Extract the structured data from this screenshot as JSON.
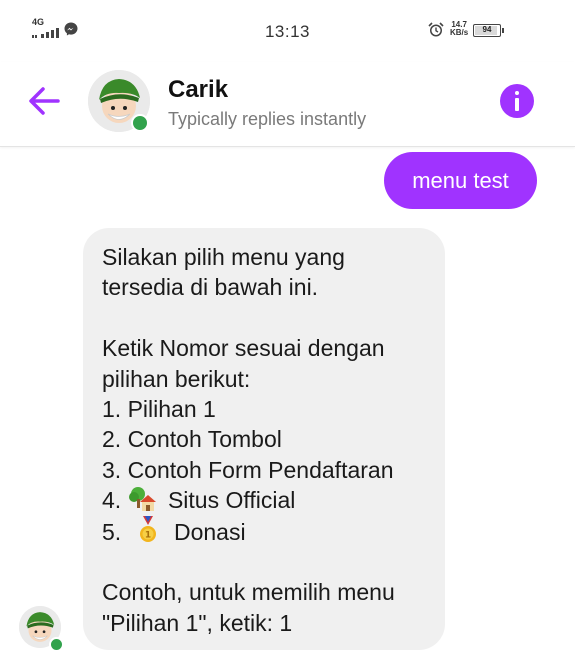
{
  "status_bar": {
    "network": "4G",
    "time": "13:13",
    "speed": "14.7",
    "speed_unit": "KB/s",
    "battery": "94",
    "battery_level_percent": 94
  },
  "header": {
    "title": "Carik",
    "subtitle": "Typically replies instantly",
    "accent_color": "#a033ff",
    "online_color": "#31a24c"
  },
  "messages": {
    "sent": "menu test",
    "received_lines": [
      "Silakan pilih menu yang",
      "tersedia di bawah ini.",
      "Ketik Nomor sesuai dengan",
      "pilihan berikut:",
      "1. Pilihan 1",
      "2. Contoh Tombol",
      "3. Contoh Form Pendaftaran",
      "4.",
      "Situs Official",
      "5.",
      "Donasi",
      "Contoh, untuk memilih menu",
      "\"Pilihan 1\", ketik: 1"
    ]
  },
  "icons": {
    "back": "back-arrow-icon",
    "info": "info-icon",
    "option_4": "house-with-tree-icon",
    "option_5": "medal-icon"
  }
}
